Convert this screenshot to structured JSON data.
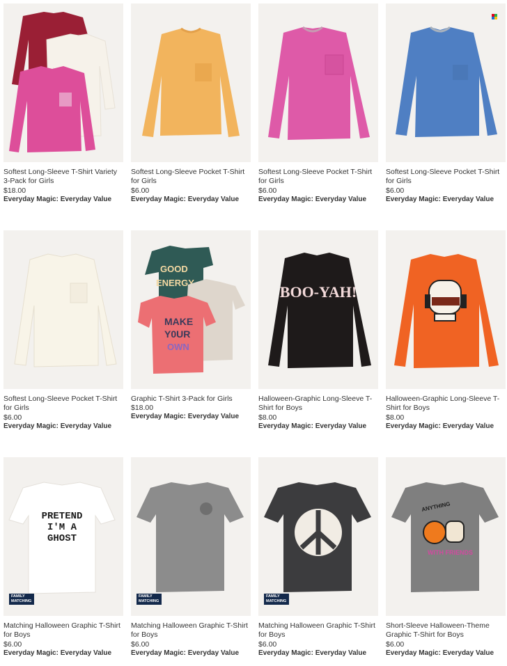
{
  "products": [
    {
      "title": "Softest Long-Sleeve T-Shirt Variety 3-Pack for Girls",
      "price": "$18.00",
      "promo": "Everyday Magic: Everyday Value",
      "image": "three long-sleeve tees maroon, cream, pink"
    },
    {
      "title": "Softest Long-Sleeve Pocket T-Shirt for Girls",
      "price": "$6.00",
      "promo": "Everyday Magic: Everyday Value",
      "image": "yellow long-sleeve pocket tee"
    },
    {
      "title": "Softest Long-Sleeve Pocket T-Shirt for Girls",
      "price": "$6.00",
      "promo": "Everyday Magic: Everyday Value",
      "image": "pink long-sleeve pocket tee"
    },
    {
      "title": "Softest Long-Sleeve Pocket T-Shirt for Girls",
      "price": "$6.00",
      "promo": "Everyday Magic: Everyday Value",
      "image": "blue long-sleeve pocket tee"
    },
    {
      "title": "Softest Long-Sleeve Pocket T-Shirt for Girls",
      "price": "$6.00",
      "promo": "Everyday Magic: Everyday Value",
      "image": "cream long-sleeve pocket tee"
    },
    {
      "title": "Graphic T-Shirt 3-Pack for Girls",
      "price": "$18.00",
      "promo": "Everyday Magic: Everyday Value",
      "image": "three graphic tees",
      "graphic_lines": [
        "GOOD",
        "ENERGY",
        "MAKE",
        "Y0UR",
        "OWN"
      ]
    },
    {
      "title": "Halloween-Graphic Long-Sleeve T-Shirt for Boys",
      "price": "$8.00",
      "promo": "Everyday Magic: Everyday Value",
      "image": "black long-sleeve tee",
      "graphic_text": "BOO-YAH!"
    },
    {
      "title": "Halloween-Graphic Long-Sleeve T-Shirt for Boys",
      "price": "$8.00",
      "promo": "Everyday Magic: Everyday Value",
      "image": "orange long-sleeve tee with skull"
    },
    {
      "title": "Matching Halloween Graphic T-Shirt for Boys",
      "price": "$6.00",
      "promo": "Everyday Magic: Everyday Value",
      "image": "white tee",
      "graphic_lines": [
        "PRETEND",
        "I'M A",
        "GHOST"
      ],
      "badge": "FAMILY MATCHING"
    },
    {
      "title": "Matching Halloween Graphic T-Shirt for Boys",
      "price": "$6.00",
      "promo": "Everyday Magic: Everyday Value",
      "image": "gray tee",
      "badge": "FAMILY MATCHING"
    },
    {
      "title": "Matching Halloween Graphic T-Shirt for Boys",
      "price": "$6.00",
      "promo": "Everyday Magic: Everyday Value",
      "image": "charcoal tee with ghost peace sign",
      "badge": "FAMILY MATCHING"
    },
    {
      "title": "Short-Sleeve Halloween-Theme Graphic T-Shirt for Boys",
      "price": "$6.00",
      "promo": "Everyday Magic: Everyday Value",
      "image": "gray tee",
      "graphic_lines": [
        "ANYTHING",
        "WITH FRIENDS"
      ]
    }
  ],
  "colors": {
    "brand_mark": [
      "#e4001b",
      "#2bb24c",
      "#1c6bd6",
      "#ffc20e"
    ]
  }
}
